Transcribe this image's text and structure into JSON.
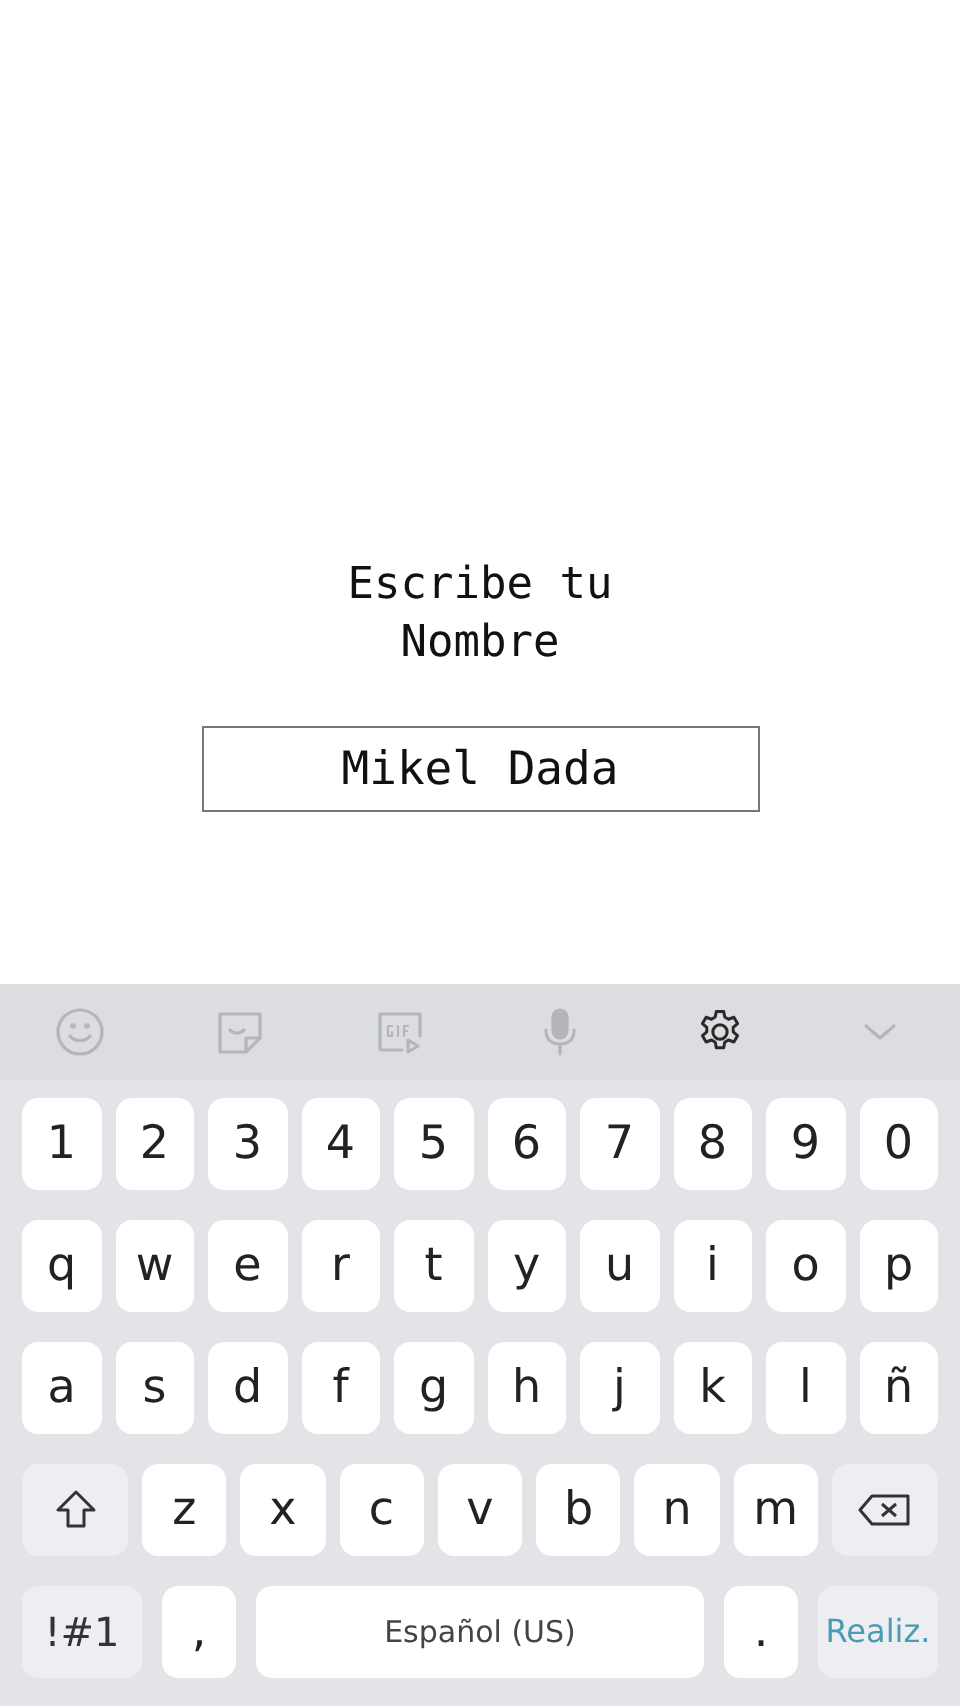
{
  "prompt": "Escribe tu Nombre",
  "name_field": {
    "value": "Mikel Dada"
  },
  "toolbar": [
    {
      "kind": "emoji",
      "disabled": true
    },
    {
      "kind": "sticker",
      "disabled": true
    },
    {
      "kind": "gif",
      "disabled": true
    },
    {
      "kind": "voice",
      "disabled": true
    },
    {
      "kind": "settings",
      "disabled": false
    },
    {
      "kind": "collapse",
      "disabled": true
    }
  ],
  "keyboard_rows": [
    [
      {
        "kind": "char",
        "label": "1"
      },
      {
        "kind": "char",
        "label": "2"
      },
      {
        "kind": "char",
        "label": "3"
      },
      {
        "kind": "char",
        "label": "4"
      },
      {
        "kind": "char",
        "label": "5"
      },
      {
        "kind": "char",
        "label": "6"
      },
      {
        "kind": "char",
        "label": "7"
      },
      {
        "kind": "char",
        "label": "8"
      },
      {
        "kind": "char",
        "label": "9"
      },
      {
        "kind": "char",
        "label": "0"
      }
    ],
    [
      {
        "kind": "char",
        "label": "q"
      },
      {
        "kind": "char",
        "label": "w"
      },
      {
        "kind": "char",
        "label": "e"
      },
      {
        "kind": "char",
        "label": "r"
      },
      {
        "kind": "char",
        "label": "t"
      },
      {
        "kind": "char",
        "label": "y"
      },
      {
        "kind": "char",
        "label": "u"
      },
      {
        "kind": "char",
        "label": "i"
      },
      {
        "kind": "char",
        "label": "o"
      },
      {
        "kind": "char",
        "label": "p"
      }
    ],
    [
      {
        "kind": "char",
        "label": "a"
      },
      {
        "kind": "char",
        "label": "s"
      },
      {
        "kind": "char",
        "label": "d"
      },
      {
        "kind": "char",
        "label": "f"
      },
      {
        "kind": "char",
        "label": "g"
      },
      {
        "kind": "char",
        "label": "h"
      },
      {
        "kind": "char",
        "label": "j"
      },
      {
        "kind": "char",
        "label": "k"
      },
      {
        "kind": "char",
        "label": "l"
      },
      {
        "kind": "char",
        "label": "ñ"
      }
    ],
    [
      {
        "kind": "shift"
      },
      {
        "kind": "char",
        "label": "z"
      },
      {
        "kind": "char",
        "label": "x"
      },
      {
        "kind": "char",
        "label": "c"
      },
      {
        "kind": "char",
        "label": "v"
      },
      {
        "kind": "char",
        "label": "b"
      },
      {
        "kind": "char",
        "label": "n"
      },
      {
        "kind": "char",
        "label": "m"
      },
      {
        "kind": "backspace"
      }
    ],
    [
      {
        "kind": "symbols",
        "label": "!#1"
      },
      {
        "kind": "punct",
        "label": ","
      },
      {
        "kind": "space",
        "label": "Español (US)"
      },
      {
        "kind": "punct",
        "label": "."
      },
      {
        "kind": "done",
        "label": "Realiz."
      }
    ]
  ]
}
